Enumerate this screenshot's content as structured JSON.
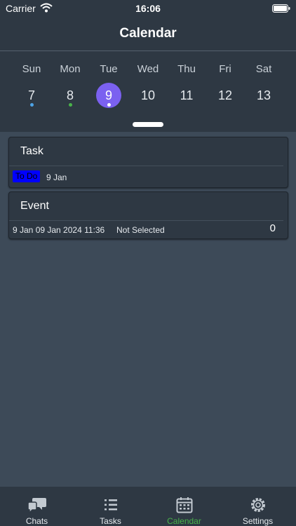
{
  "status_bar": {
    "carrier": "Carrier",
    "time": "16:06"
  },
  "nav": {
    "title": "Calendar"
  },
  "week": {
    "days": [
      {
        "name": "Sun",
        "number": "7",
        "dot_color": "#4da3e6"
      },
      {
        "name": "Mon",
        "number": "8",
        "dot_color": "#49b34a"
      },
      {
        "name": "Tue",
        "number": "9",
        "dot_color": "#ffffff",
        "selected": true
      },
      {
        "name": "Wed",
        "number": "10"
      },
      {
        "name": "Thu",
        "number": "11"
      },
      {
        "name": "Fri",
        "number": "12"
      },
      {
        "name": "Sat",
        "number": "13"
      }
    ]
  },
  "items": {
    "task": {
      "title": "Task",
      "status": "To Do",
      "date": "9 Jan"
    },
    "event": {
      "title": "Event",
      "date_info": "9 Jan 09 Jan 2024 11:36",
      "selection": "Not Selected",
      "count": "0"
    }
  },
  "tabs": [
    {
      "label": "Chats",
      "icon": "chats-icon"
    },
    {
      "label": "Tasks",
      "icon": "tasks-icon"
    },
    {
      "label": "Calendar",
      "icon": "calendar-icon",
      "active": true
    },
    {
      "label": "Settings",
      "icon": "settings-icon"
    }
  ],
  "colors": {
    "accent_selected": "#7b61f0",
    "tab_active": "#49b34a",
    "status_badge": "#0000ff"
  }
}
